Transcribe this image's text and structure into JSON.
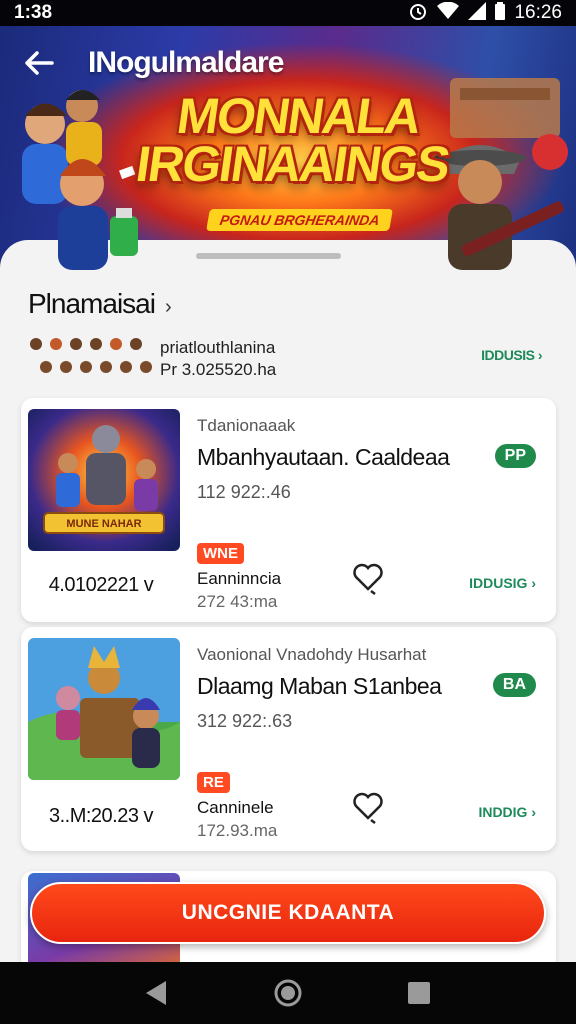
{
  "status_bar": {
    "time": "1:38",
    "clock": "16:26"
  },
  "header": {
    "title": "INogulmaldare"
  },
  "banner": {
    "title_line1": "MONNALA",
    "title_line2": "IRGINAAINGS",
    "subtitle": "PGNAU BRGHERAINDA"
  },
  "section": {
    "title": "Plnamaisai",
    "meta_line1": "priatlouthlanina",
    "meta_line2": "Pr 3.025520.ha",
    "action": "IDDUSIS"
  },
  "cards": [
    {
      "publisher": "Tdanionaaak",
      "title": "Mbanhyautaan. Caaldeaa",
      "badge": "PP",
      "rating": "112 922:.46",
      "tag": "WNE",
      "date": "4.0102221",
      "stat_label": "Eanninncia",
      "stat_value": "272 43:ma",
      "action": "IDDUSIG",
      "thumb_text": "MUNE NAHAR"
    },
    {
      "publisher": "Vaonional Vnadohdy Husarhat",
      "title": "Dlaamg Maban S1anbea",
      "badge": "BA",
      "rating": "312 922:.63",
      "tag": "RE",
      "date": "3..M:20.23",
      "stat_label": "Canninele",
      "stat_value": "172.93.ma",
      "action": "INDDIG"
    }
  ],
  "cta": {
    "label": "UNCGNIE KDAANTA"
  },
  "colors": {
    "accent_green": "#1f8a4c",
    "cta_red": "#ff3a16",
    "tag_red": "#ff4a22"
  }
}
